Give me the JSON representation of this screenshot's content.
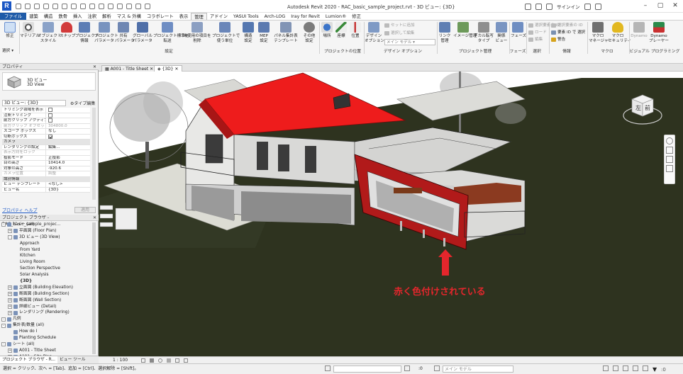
{
  "window": {
    "title": "Autodesk Revit 2020 - RAC_basic_sample_project.rvt - 3D ビュー: {3D}",
    "signin": "サインイン"
  },
  "ribbon_tabs": [
    "ファイル",
    "建築",
    "構造",
    "鉄骨",
    "挿入",
    "注釈",
    "解析",
    "マス & 外構",
    "コラボレート",
    "表示",
    "管理",
    "アドイン",
    "YASUI Tools",
    "Arch-LOG",
    "Iray for Revit",
    "Lumion®",
    "修正"
  ],
  "ribbon": {
    "modify": "修正",
    "select_label": "選択",
    "buttons": [
      {
        "label": "マテリアル"
      },
      {
        "label": "オブジェクト\nスタイル"
      },
      {
        "label": "スナップ"
      },
      {
        "label": "プロジェクト\n情報"
      },
      {
        "label": "プロジェクト\nパラメータ"
      },
      {
        "label": "共有\nパラメータ"
      },
      {
        "label": "グローバル\nパラメータ"
      },
      {
        "label": "プロジェクト標準を\n転送"
      },
      {
        "label": "未使用の項目を\n削除"
      },
      {
        "label": "プロジェクトで\n使う単位"
      },
      {
        "label": "構造\n設定"
      },
      {
        "label": "MEP\n設定"
      },
      {
        "label": "パネル集計表\nテンプレート"
      },
      {
        "label": "その他\n設定"
      },
      {
        "label": "場所"
      },
      {
        "label": "座標"
      },
      {
        "label": "位置"
      },
      {
        "label": "デザイン\nオプション"
      },
      {
        "label": "リンク\n管理"
      },
      {
        "label": "イメージ管理"
      },
      {
        "label": "デカル転写\nタイプ"
      },
      {
        "label": "関係\nビュー"
      },
      {
        "label": "フェーズ"
      },
      {
        "label": "マクロ\nマネージャ"
      },
      {
        "label": "マクロ\nセキュリティ"
      },
      {
        "label": "Dynamo"
      },
      {
        "label": "Dynamo\nプレーヤー"
      }
    ],
    "small": {
      "add_to_set": "セットに追加",
      "pick_to_edit": "選択して編集",
      "main_model": "メイン モデル",
      "select_id": "選択要素の ID",
      "load": "ロード",
      "edit": "編集",
      "select_by_id": "要素 ID で 選択",
      "warnings": "警告"
    },
    "panels": {
      "settings": "設定",
      "project_location": "プロジェクトの位置",
      "design_options": "デザイン オプション",
      "manage_project": "プロジェクト管理",
      "phases": "フェーズ",
      "selection": "選択",
      "inquiry": "情報",
      "macros": "マクロ",
      "visual_programming": "ビジュアル プログラミング"
    }
  },
  "properties": {
    "header": "プロパティ",
    "type_name1": "3D ビュー",
    "type_name2": "3D View",
    "instance_selector": "3D ビュー: {3D}",
    "edit_type": "タイプ編集",
    "rows": [
      {
        "k": "トリミング領域を表示",
        "v": "",
        "cb": false
      },
      {
        "k": "注釈トリミング",
        "v": "",
        "cb": false
      },
      {
        "k": "前方クリップ アクティブ",
        "v": "",
        "cb": false
      },
      {
        "k": "前方クリップ オフセット",
        "v": "304800.0",
        "dim": true
      },
      {
        "k": "スコープ ボックス",
        "v": "なし"
      },
      {
        "k": "切断ボックス",
        "v": "",
        "cb": true
      },
      {
        "k": "カメラ",
        "v": "",
        "grp": true
      },
      {
        "k": "レンダリングの設定",
        "v": "編集..."
      },
      {
        "k": "表示方向をロック",
        "v": "",
        "dim": true
      },
      {
        "k": "投影モード",
        "v": "正投影"
      },
      {
        "k": "目の高さ",
        "v": "10414.0"
      },
      {
        "k": "対象の高さ",
        "v": "-920.6"
      },
      {
        "k": "カメラ位置",
        "v": "調整",
        "dim": true
      },
      {
        "k": "識別情報",
        "v": "",
        "grp": true
      },
      {
        "k": "ビュー テンプレート",
        "v": "<なし>"
      },
      {
        "k": "ビュー名",
        "v": "{3D}"
      }
    ],
    "help_link": "プロパティ ヘルプ",
    "apply": "適用"
  },
  "browser": {
    "header": "プロジェクト ブラウザ - RAC_basic_sample_projec...",
    "items": [
      {
        "label": "ビュー (all)",
        "lvl": 0,
        "tog": "-"
      },
      {
        "label": "平面図 (Floor Plan)",
        "lvl": 1,
        "tog": "+"
      },
      {
        "label": "3D ビュー (3D View)",
        "lvl": 1,
        "tog": "-"
      },
      {
        "label": "Approach",
        "lvl": 2
      },
      {
        "label": "From Yard",
        "lvl": 2
      },
      {
        "label": "Kitchen",
        "lvl": 2
      },
      {
        "label": "Living Room",
        "lvl": 2
      },
      {
        "label": "Section Perspective",
        "lvl": 2
      },
      {
        "label": "Solar Analysis",
        "lvl": 2
      },
      {
        "label": "{3D}",
        "lvl": 2,
        "bold": true
      },
      {
        "label": "立面図 (Building Elevation)",
        "lvl": 1,
        "tog": "+"
      },
      {
        "label": "断面図 (Building Section)",
        "lvl": 1,
        "tog": "+"
      },
      {
        "label": "断面図 (Wall Section)",
        "lvl": 1,
        "tog": "+"
      },
      {
        "label": "詳細ビュー (Detail)",
        "lvl": 1,
        "tog": "+"
      },
      {
        "label": "レンダリング (Rendering)",
        "lvl": 1,
        "tog": "+"
      },
      {
        "label": "凡例",
        "lvl": 0,
        "tog": "-"
      },
      {
        "label": "集計表/数量 (all)",
        "lvl": 0,
        "tog": "-"
      },
      {
        "label": "How do I",
        "lvl": 1
      },
      {
        "label": "Planting Schedule",
        "lvl": 1
      },
      {
        "label": "シート (all)",
        "lvl": 0,
        "tog": "-"
      },
      {
        "label": "A001 - Title Sheet",
        "lvl": 1,
        "tog": "+"
      },
      {
        "label": "A101 - Site Plan",
        "lvl": 1,
        "tog": "+"
      }
    ],
    "bottom_tabs": [
      "プロジェクト ブラウザ - R...",
      "ビュー ツール"
    ]
  },
  "view_tabs": [
    "A001 - Title Sheet",
    "{3D}"
  ],
  "viewcube": {
    "left": "左",
    "front": "前"
  },
  "annotation": "赤く色付けされている",
  "view_control": {
    "scale": "1 : 100"
  },
  "status": {
    "hint": "選択 = クリック、次へ = [Tab]、追加 = [Ctrl]、選択解除 = [Shift]。",
    "zero": ":0",
    "model": "メイン モデル"
  },
  "colors": {
    "accent": "#1f5ba8",
    "highlight_red": "#e4262c",
    "roof_red": "#ee1c1c"
  }
}
